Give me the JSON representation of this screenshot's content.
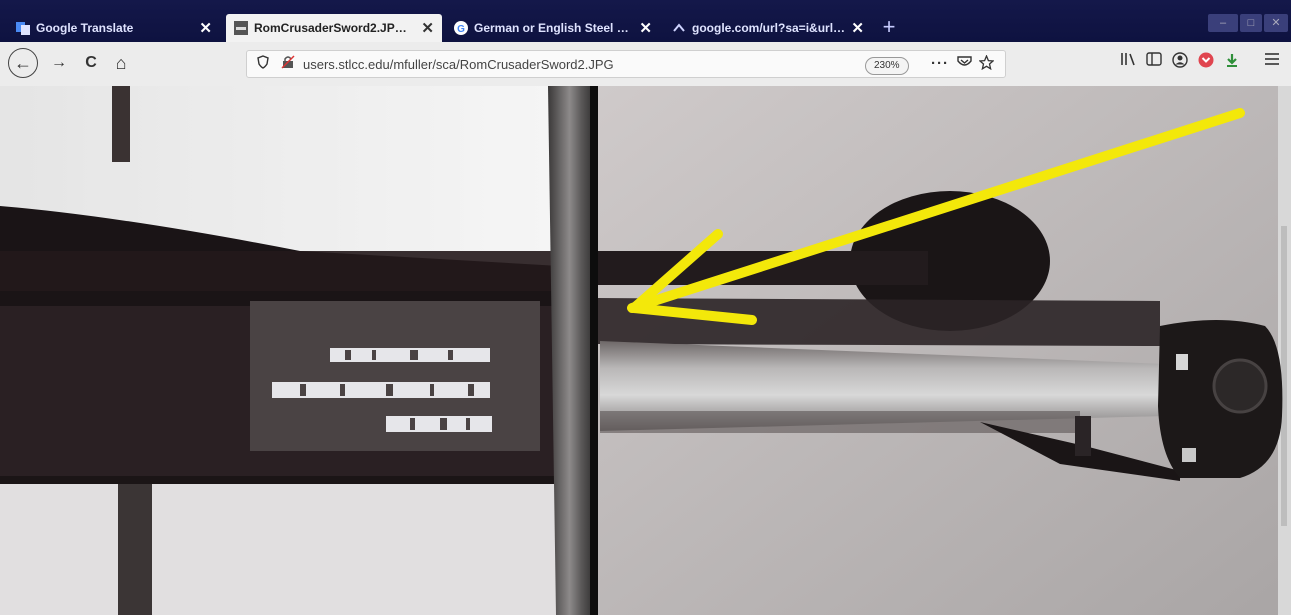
{
  "tabs": [
    {
      "title": "Google Translate",
      "icon": "google-translate-icon",
      "active": false
    },
    {
      "title": "RomCrusaderSword2.JPG (JPEG",
      "icon": "image-thumbnail-icon",
      "active": true
    },
    {
      "title": "German or English Steel Sword",
      "icon": "google-icon",
      "active": false
    },
    {
      "title": "google.com/url?sa=i&url=http",
      "icon": "link-icon",
      "active": false
    }
  ],
  "tab_close_glyph": "✕",
  "new_tab_glyph": "+",
  "nav": {
    "back_glyph": "←",
    "forward_glyph": "→",
    "reload_glyph": "C",
    "home_glyph": "⌂",
    "url": "users.stlcc.edu/mfuller/sca/RomCrusaderSword2.JPG",
    "zoom": "230%",
    "more_glyph": "···"
  },
  "colors": {
    "tabbar": "#14184a",
    "active_tab": "#f2f2f2",
    "arrow": "#f3e80a",
    "pocket": "#e0454f"
  },
  "content": {
    "image_subject": "close-up of a sword blade and crossguard with inscription, annotated with a yellow arrow"
  }
}
